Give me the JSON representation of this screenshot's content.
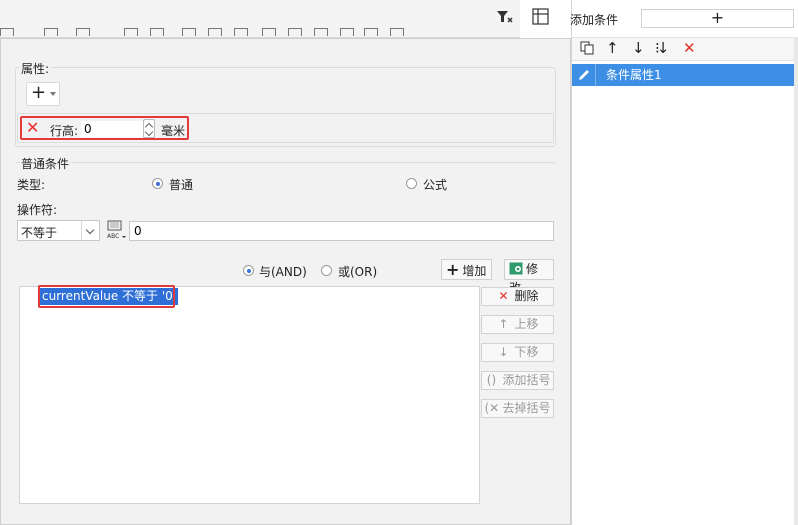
{
  "attributes": {
    "section_label": "属性:",
    "add_button_symbol": "+",
    "row_height_label": "行高:",
    "row_height_value": "0",
    "unit_label": "毫米"
  },
  "condition": {
    "section_label": "普通条件",
    "type_label": "类型:",
    "type_options": [
      "普通",
      "公式"
    ],
    "type_selected": "普通",
    "operator_label": "操作符:",
    "operator_selected": "不等于",
    "operand_value": "0",
    "join_options": [
      "与(AND)",
      "或(OR)"
    ],
    "join_selected": "与(AND)",
    "add_label": "增加",
    "modify_label": "修改",
    "list_items": [
      "currentValue 不等于 '0'"
    ],
    "side_buttons": {
      "delete": "删除",
      "move_up": "上移",
      "move_down": "下移",
      "add_bracket": "添加括号",
      "remove_bracket": "去掉括号"
    }
  },
  "right_panel": {
    "add_condition_label": "添加条件",
    "add_condition_symbol": "+",
    "items": [
      "条件属性1"
    ]
  },
  "colors": {
    "highlight_border": "#e03b3b",
    "selection": "#2d6fd6",
    "right_selection": "#3d8fe5",
    "delete_red": "#e8302b"
  }
}
